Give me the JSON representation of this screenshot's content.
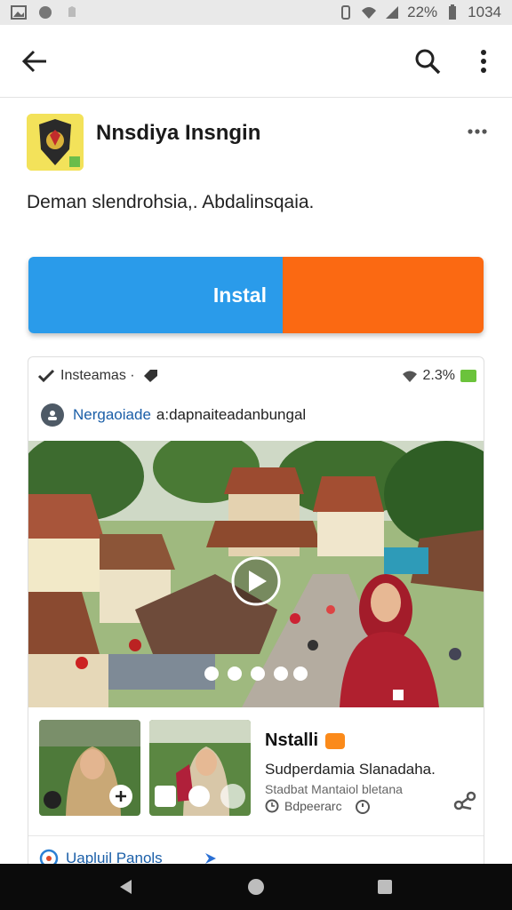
{
  "status_bar": {
    "battery_percent": "22%",
    "time": "1034"
  },
  "app_bar": {
    "back_icon": "arrow-back-icon",
    "search_icon": "search-icon",
    "more_icon": "more-vert-icon"
  },
  "app": {
    "name": "Nnsdiya Insngin",
    "description": "Deman slendrohsia,. Abdalinsqaia.",
    "install_label": "Instal"
  },
  "card": {
    "top_label": "Insteamas ·",
    "top_right_value": "2.3%",
    "developer_name": "Nergaoiade",
    "developer_sub": "a:dapnaiteadanbungal",
    "info_title": "Nstalli",
    "info_line1": "Sudperdamia Slanadaha.",
    "info_line2": "Stadbat Mantaiol bletana",
    "info_meta": "Bdpeerarc",
    "footer_link": "Uapluil Panols"
  },
  "colors": {
    "install_blue": "#2a9bea",
    "accent_orange": "#fb6912",
    "link_blue": "#1b5fa8"
  }
}
